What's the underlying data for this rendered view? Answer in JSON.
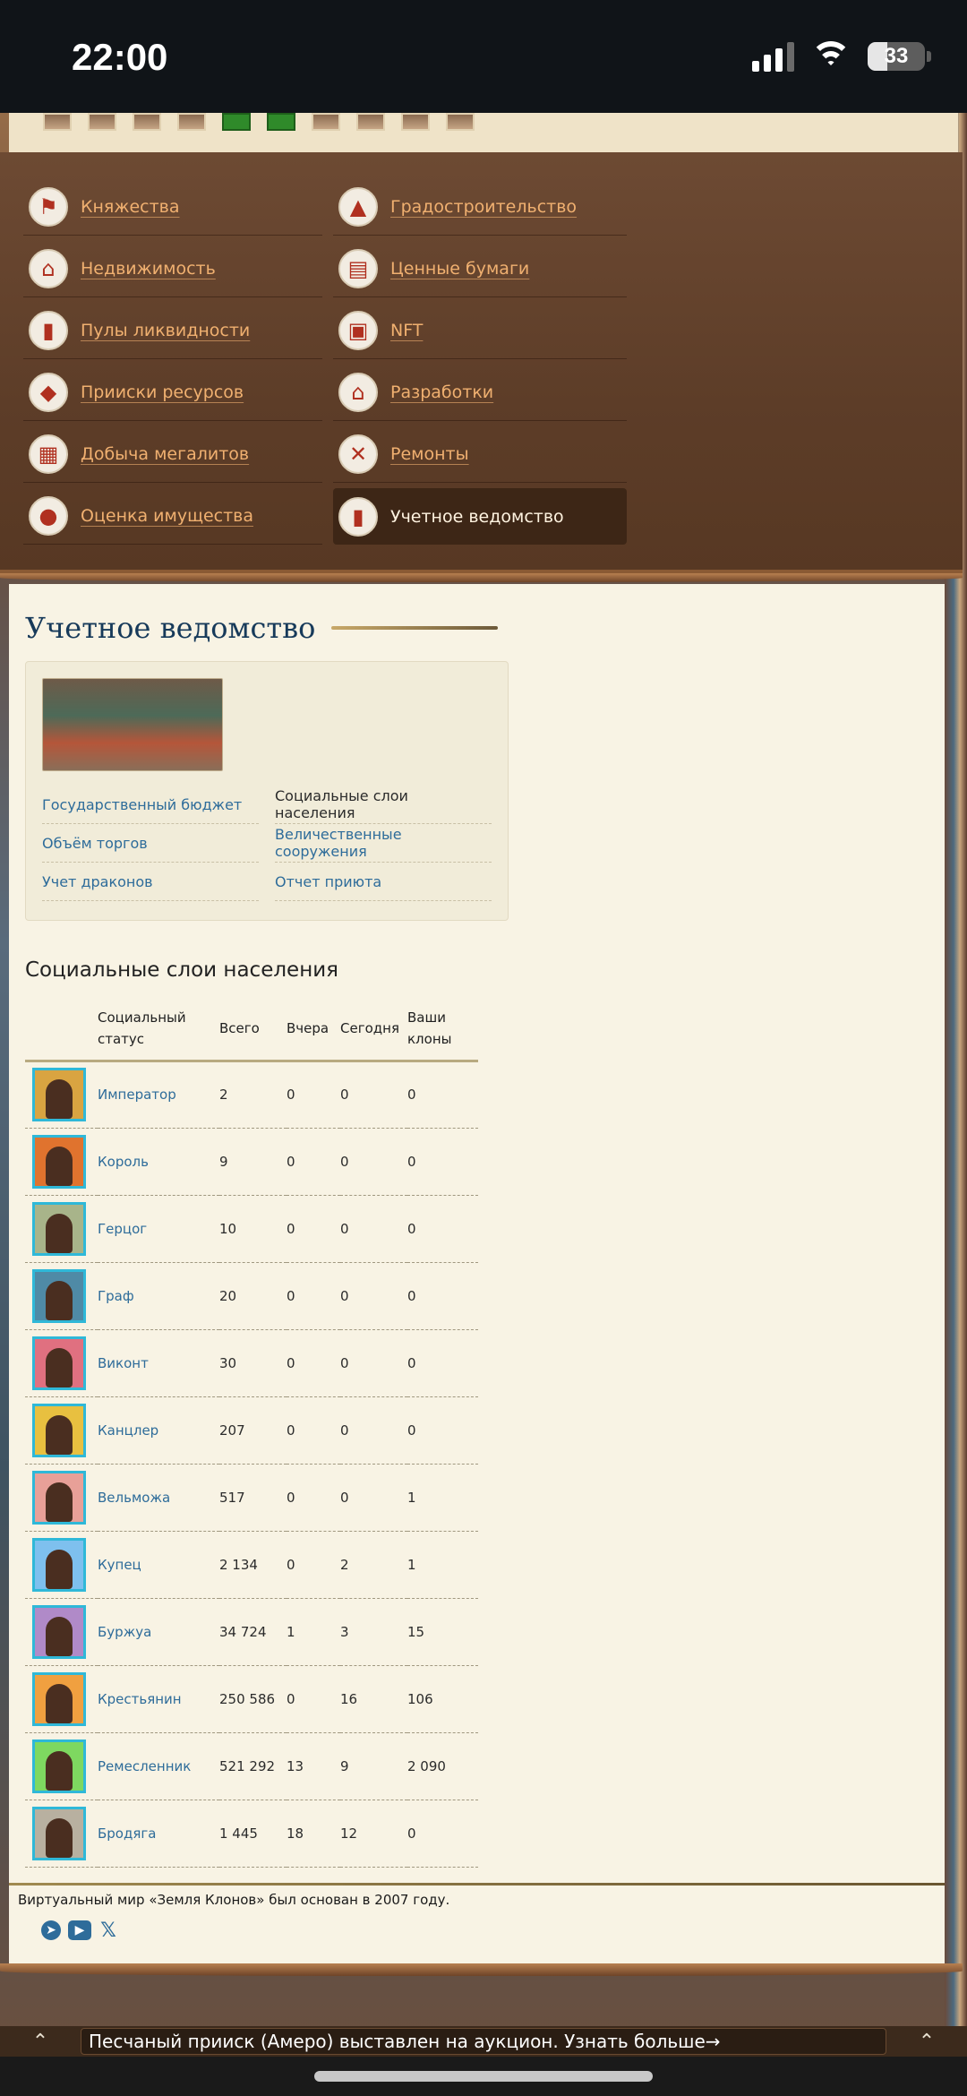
{
  "status_bar": {
    "time": "22:00",
    "battery": "33",
    "icons": [
      "signal-icon",
      "wifi-icon",
      "battery-icon"
    ]
  },
  "menu": {
    "items": [
      {
        "label": "Княжества",
        "icon": "flag-icon",
        "glyph": "⚑"
      },
      {
        "label": "Градостроительство",
        "icon": "city-icon",
        "glyph": "▲"
      },
      {
        "label": "Недвижимость",
        "icon": "house-icon",
        "glyph": "⌂"
      },
      {
        "label": "Ценные бумаги",
        "icon": "certificate-icon",
        "glyph": "▤"
      },
      {
        "label": "Пулы ликвидности",
        "icon": "bar-chart-icon",
        "glyph": "▮"
      },
      {
        "label": "NFT",
        "icon": "nft-icon",
        "glyph": "▣"
      },
      {
        "label": "Прииски ресурсов",
        "icon": "gem-icon",
        "glyph": "◆"
      },
      {
        "label": "Разработки",
        "icon": "mine-icon",
        "glyph": "⌂"
      },
      {
        "label": "Добыча мегалитов",
        "icon": "stone-blocks-icon",
        "glyph": "▦"
      },
      {
        "label": "Ремонты",
        "icon": "tools-icon",
        "glyph": "✕"
      },
      {
        "label": "Оценка имущества",
        "icon": "coins-icon",
        "glyph": "●"
      },
      {
        "label": "Учетное ведомство",
        "icon": "stats-icon",
        "glyph": "▮",
        "active": true
      }
    ]
  },
  "page": {
    "title": "Учетное ведомство"
  },
  "card": {
    "links": [
      {
        "label": "Государственный бюджет"
      },
      {
        "label": "Социальные слои населения",
        "current": true
      },
      {
        "label": "Объём торгов"
      },
      {
        "label": "Величественные сооружения"
      },
      {
        "label": "Учет драконов"
      },
      {
        "label": "Отчет приюта"
      }
    ]
  },
  "table": {
    "title": "Социальные слои населения",
    "headers": {
      "status": "Социальный статус",
      "total": "Всего",
      "yesterday": "Вчера",
      "today": "Сегодня",
      "yours": "Ваши клоны"
    },
    "rows": [
      {
        "status": "Император",
        "total": "2",
        "yesterday": "0",
        "today": "0",
        "yours": "0",
        "bg": "#d9a441"
      },
      {
        "status": "Король",
        "total": "9",
        "yesterday": "0",
        "today": "0",
        "yours": "0",
        "bg": "#e0732e"
      },
      {
        "status": "Герцог",
        "total": "10",
        "yesterday": "0",
        "today": "0",
        "yours": "0",
        "bg": "#a8b48a"
      },
      {
        "status": "Граф",
        "total": "20",
        "yesterday": "0",
        "today": "0",
        "yours": "0",
        "bg": "#4f8aa6"
      },
      {
        "status": "Виконт",
        "total": "30",
        "yesterday": "0",
        "today": "0",
        "yours": "0",
        "bg": "#e07080"
      },
      {
        "status": "Канцлер",
        "total": "207",
        "yesterday": "0",
        "today": "0",
        "yours": "0",
        "bg": "#e8c040"
      },
      {
        "status": "Вельможа",
        "total": "517",
        "yesterday": "0",
        "today": "0",
        "yours": "1",
        "bg": "#e8a098"
      },
      {
        "status": "Купец",
        "total": "2 134",
        "yesterday": "0",
        "today": "2",
        "yours": "1",
        "bg": "#7ec0ee"
      },
      {
        "status": "Буржуа",
        "total": "34 724",
        "yesterday": "1",
        "today": "3",
        "yours": "15",
        "bg": "#b08ac8"
      },
      {
        "status": "Крестьянин",
        "total": "250 586",
        "yesterday": "0",
        "today": "16",
        "yours": "106",
        "bg": "#f0a040"
      },
      {
        "status": "Ремесленник",
        "total": "521 292",
        "yesterday": "13",
        "today": "9",
        "yours": "2 090",
        "bg": "#7ed860"
      },
      {
        "status": "Бродяга",
        "total": "1 445",
        "yesterday": "18",
        "today": "12",
        "yours": "0",
        "bg": "#b8b0a0"
      }
    ]
  },
  "footer": {
    "text": "Виртуальный мир «Земля Клонов» был основан в 2007 году.",
    "socials": [
      {
        "name": "telegram-icon",
        "glyph": "➤"
      },
      {
        "name": "youtube-icon",
        "glyph": "▶"
      },
      {
        "name": "x-icon",
        "glyph": "𝕏"
      }
    ]
  },
  "ticker": {
    "text": "Песчаный прииск (Амеро) выставлен на аукцион. Узнать больше→"
  },
  "colors": {
    "link": "#2e6c9a",
    "menu_link": "#f0b070",
    "heading": "#173a5a",
    "avatar_border": "#2fb8d8"
  }
}
